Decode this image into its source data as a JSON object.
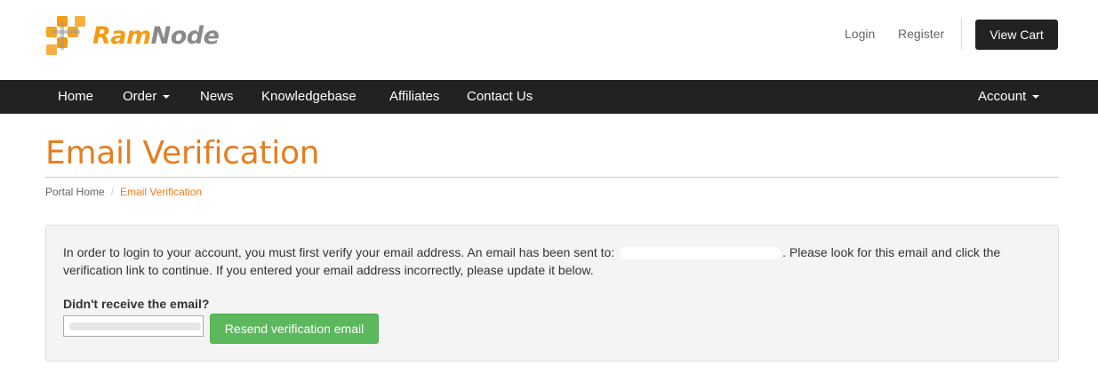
{
  "header": {
    "logo": {
      "part1": "Ram",
      "part2": "Node"
    },
    "login": "Login",
    "register": "Register",
    "view_cart": "View Cart"
  },
  "nav": {
    "home": "Home",
    "order": "Order",
    "news": "News",
    "knowledgebase": "Knowledgebase",
    "affiliates": "Affiliates",
    "contact": "Contact Us",
    "account": "Account"
  },
  "page": {
    "title": "Email Verification",
    "breadcrumb": {
      "home": "Portal Home",
      "separator": "/",
      "current": "Email Verification"
    }
  },
  "verification": {
    "message_part1": "In order to login to your account, you must first verify your email address. An email has been sent to:",
    "message_part2": ". Please look for this email and click the verification link to continue. If you entered your email address incorrectly, please update it below.",
    "didnt_receive": "Didn't receive the email?",
    "resend_button": "Resend verification email"
  },
  "colors": {
    "accent": "#e67e22",
    "logo_orange": "#f39c12",
    "nav_bg": "#222222",
    "success": "#5cb85c"
  }
}
